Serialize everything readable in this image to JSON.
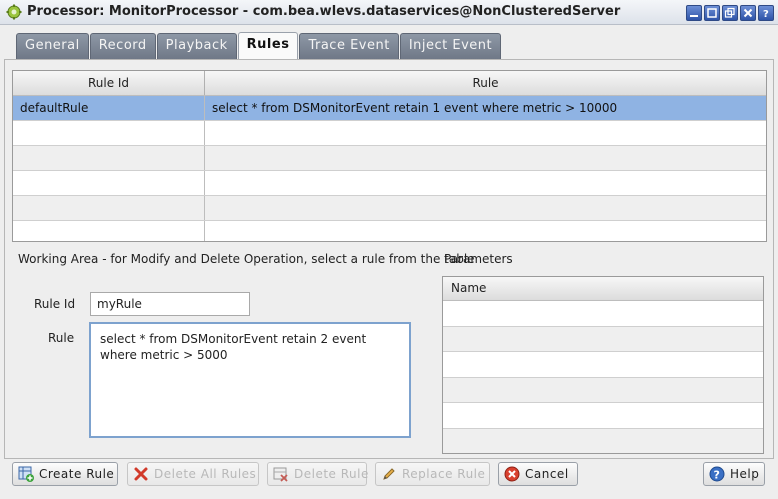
{
  "window": {
    "title": "Processor: MonitorProcessor - com.bea.wlevs.dataservices@NonClusteredServer"
  },
  "tabs": [
    {
      "label": "General",
      "active": false
    },
    {
      "label": "Record",
      "active": false
    },
    {
      "label": "Playback",
      "active": false
    },
    {
      "label": "Rules",
      "active": true
    },
    {
      "label": "Trace Event",
      "active": false
    },
    {
      "label": "Inject Event",
      "active": false
    }
  ],
  "rules_table": {
    "headers": [
      "Rule Id",
      "Rule"
    ],
    "rows": [
      {
        "rule_id": "defaultRule",
        "rule": "select * from DSMonitorEvent retain 1 event where metric > 10000",
        "selected": true
      },
      {
        "rule_id": "",
        "rule": ""
      },
      {
        "rule_id": "",
        "rule": ""
      },
      {
        "rule_id": "",
        "rule": ""
      },
      {
        "rule_id": "",
        "rule": ""
      }
    ]
  },
  "working_area": {
    "label": "Working Area - for Modify and Delete Operation, select a rule from the table",
    "rule_id_label": "Rule Id",
    "rule_id_value": "myRule",
    "rule_label": "Rule",
    "rule_value": "select * from DSMonitorEvent retain 2 event where metric > 5000"
  },
  "parameters": {
    "label": "Parameters",
    "header": "Name",
    "rows": [
      "",
      "",
      "",
      "",
      "",
      ""
    ]
  },
  "buttons": {
    "create": "Create Rule",
    "delete_all": "Delete All Rules",
    "delete": "Delete Rule",
    "replace": "Replace Rule",
    "cancel": "Cancel",
    "help": "Help"
  },
  "colors": {
    "selected_row": "#8fb3e3",
    "tab_inactive": "#7f8896",
    "focus_border": "#7da2ce"
  }
}
